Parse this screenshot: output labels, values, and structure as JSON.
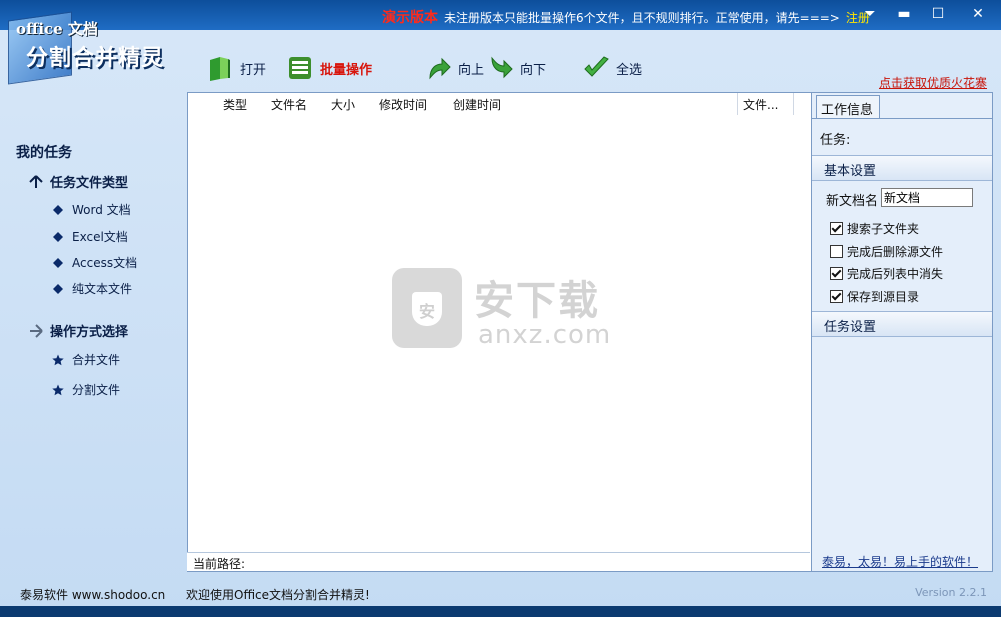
{
  "logo": {
    "line1": "office 文档",
    "line2": "分割合并精灵"
  },
  "notice": {
    "badge": "演示版本",
    "text": "未注册版本只能批量操作6个文件，且不规则排行。正常使用，请先===>",
    "register": "注册"
  },
  "window_controls": {
    "menu": "⏷",
    "minimize": "▬",
    "maximize": "☐",
    "close": "✕"
  },
  "toolbar": {
    "open": "打开",
    "batch": "批量操作",
    "up": "向上",
    "down": "向下",
    "select_all": "全选",
    "promo_link": "点击获取优质火花寨"
  },
  "sidebar": {
    "title": "我的任务",
    "group1": "任务文件类型",
    "types": [
      "Word 文档",
      "Excel文档",
      "Access文档",
      "纯文本文件"
    ],
    "group2": "操作方式选择",
    "ops": [
      "合并文件",
      "分割文件"
    ]
  },
  "filelist": {
    "columns": [
      "类型",
      "文件名",
      "大小",
      "修改时间",
      "创建时间",
      "文件..."
    ],
    "watermark_cn": "安下载",
    "watermark_en": "anxz.com",
    "watermark_badge": "安",
    "path_label": "当前路径:"
  },
  "rpanel": {
    "tab": "工作信息",
    "task_label": "任务:",
    "basic_settings": "基本设置",
    "new_doc_label": "新文档名",
    "new_doc_value": "新文档",
    "checks": [
      {
        "label": "搜索子文件夹",
        "checked": true
      },
      {
        "label": "完成后删除源文件",
        "checked": false
      },
      {
        "label": "完成后列表中消失",
        "checked": true
      },
      {
        "label": "保存到源目录",
        "checked": true
      }
    ],
    "task_settings": "任务设置",
    "slogan": "泰易，太易！易上手的软件！"
  },
  "status": {
    "company": "泰易软件 www.shodoo.cn",
    "welcome": "欢迎使用Office文档分割合并精灵!",
    "version": "Version 2.2.1"
  },
  "colors": {
    "accent_red": "#d8150c",
    "title_blue": "#1f6cc4",
    "register_yellow": "#ffe600"
  }
}
